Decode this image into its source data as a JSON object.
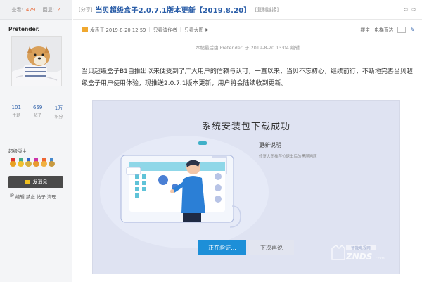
{
  "stats": {
    "views_label": "查看:",
    "views": "479",
    "sep": "|",
    "replies_label": "回复:",
    "replies": "2"
  },
  "thread": {
    "category": "[分享]",
    "title": "当贝超级盒子2.0.7.1版本更新【2019.8.20】",
    "copy_link": "[复制链接]"
  },
  "user": {
    "name": "Pretender.",
    "stats": [
      {
        "value": "101",
        "label": "主题"
      },
      {
        "value": "659",
        "label": "帖子"
      },
      {
        "value": "1万",
        "label": "积分"
      }
    ],
    "group": "超级版主",
    "message_button": "发消息",
    "actions": [
      "IP",
      "编辑",
      "禁止",
      "帖子",
      "清理"
    ]
  },
  "meta": {
    "posted": "发表于 2019-8-20 12:59",
    "author_only": "只看该作者",
    "big_image": "只看大图",
    "floor": "楼主",
    "mode": "电梯直达"
  },
  "edited_note": "本帖最后由 Pretender. 于 2019-8-20 13:04 编辑",
  "body": "当贝超级盒子B1自推出以来便受到了广大用户的信赖与认可，一直以来，当贝不忘初心，继续前行，不断地完善当贝超级盒子用户使用体验，现推送2.0.7.1版本更新，用户将会陆续收到更新。",
  "dialog": {
    "title": "系统安装包下载成功",
    "update_title": "更新说明",
    "update_desc": "修复大图推荐位退出后的黑屏问题",
    "verify_button": "正在验证...",
    "later_button": "下次再说",
    "watermark_top": "智能电视网",
    "watermark": "ZNDS",
    "watermark_suffix": ".com"
  },
  "colors": {
    "accent": "#2b5ea8",
    "verify": "#1d8fd8",
    "stat_num": "#e86b3a"
  }
}
